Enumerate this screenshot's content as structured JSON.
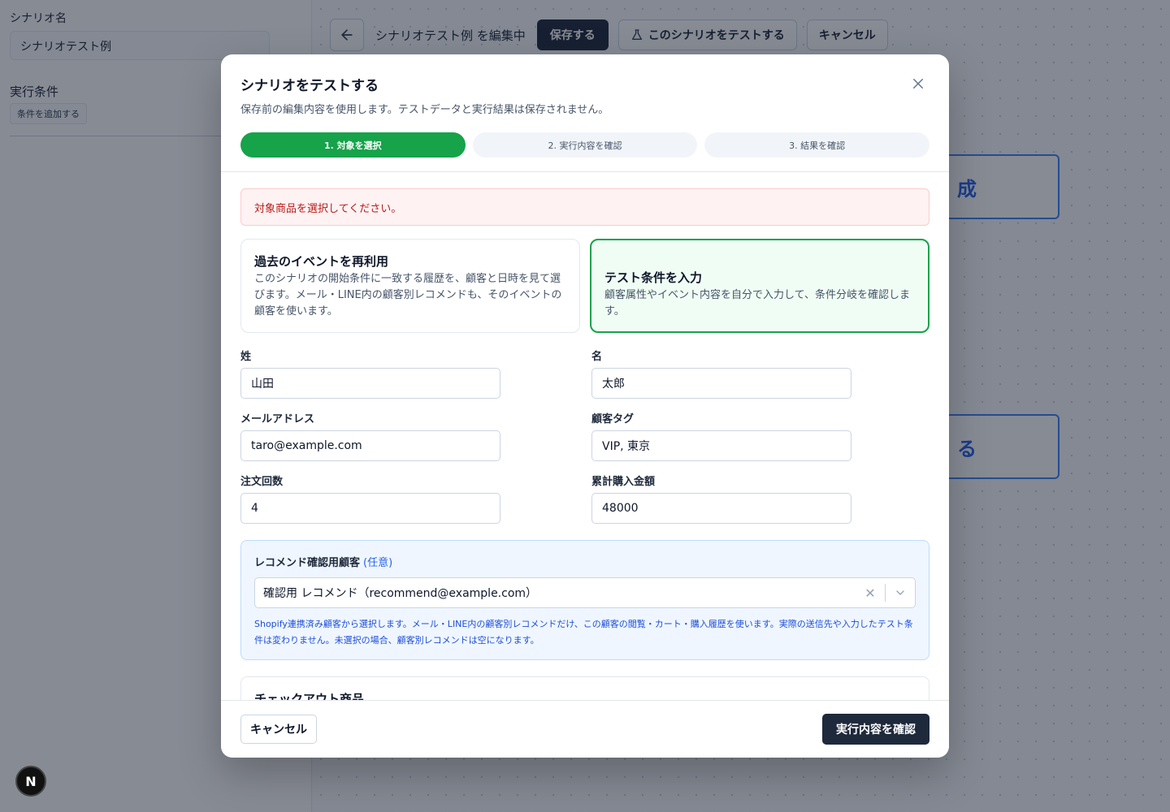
{
  "sidebar": {
    "scenario_name_label": "シナリオ名",
    "scenario_name_value": "シナリオテスト例",
    "conditions_label": "実行条件",
    "add_condition_label": "条件を追加する"
  },
  "toolbar": {
    "title": "シナリオテスト例 を編集中",
    "save_label": "保存する",
    "test_label": "このシナリオをテストする",
    "cancel_label": "キャンセル"
  },
  "canvas": {
    "node1_text": "成",
    "node2_text": "る"
  },
  "fab": {
    "label": "N"
  },
  "modal": {
    "title": "シナリオをテストする",
    "subtitle": "保存前の編集内容を使用します。テストデータと実行結果は保存されません。",
    "steps": [
      {
        "label": "1. 対象を選択"
      },
      {
        "label": "2. 実行内容を確認"
      },
      {
        "label": "3. 結果を確認"
      }
    ],
    "alert": "対象商品を選択してください。",
    "modes": [
      {
        "title": "過去のイベントを再利用",
        "description": "このシナリオの開始条件に一致する履歴を、顧客と日時を見て選びます。メール・LINE内の顧客別レコメンドも、そのイベントの顧客を使います。"
      },
      {
        "title": "テスト条件を入力",
        "description": "顧客属性やイベント内容を自分で入力して、条件分岐を確認します。"
      }
    ],
    "fields": {
      "last_name": {
        "label": "姓",
        "value": "山田"
      },
      "first_name": {
        "label": "名",
        "value": "太郎"
      },
      "email": {
        "label": "メールアドレス",
        "value": "taro@example.com"
      },
      "tags": {
        "label": "顧客タグ",
        "value": "VIP, 東京"
      },
      "orders": {
        "label": "注文回数",
        "value": "4"
      },
      "total_spent": {
        "label": "累計購入金額",
        "value": "48000"
      }
    },
    "recommend": {
      "title": "レコメンド確認用顧客",
      "optional": "(任意)",
      "selected": "確認用 レコメンド（recommend@example.com）",
      "help": "Shopify連携済み顧客から選択します。メール・LINE内の顧客別レコメンドだけ、この顧客の閲覧・カート・購入履歴を使います。実際の送信先や入力したテスト条件は変わりません。未選択の場合、顧客別レコメンドは空になります。"
    },
    "checkout_title": "チェックアウト商品",
    "cancel_label": "キャンセル",
    "confirm_label": "実行内容を確認"
  }
}
